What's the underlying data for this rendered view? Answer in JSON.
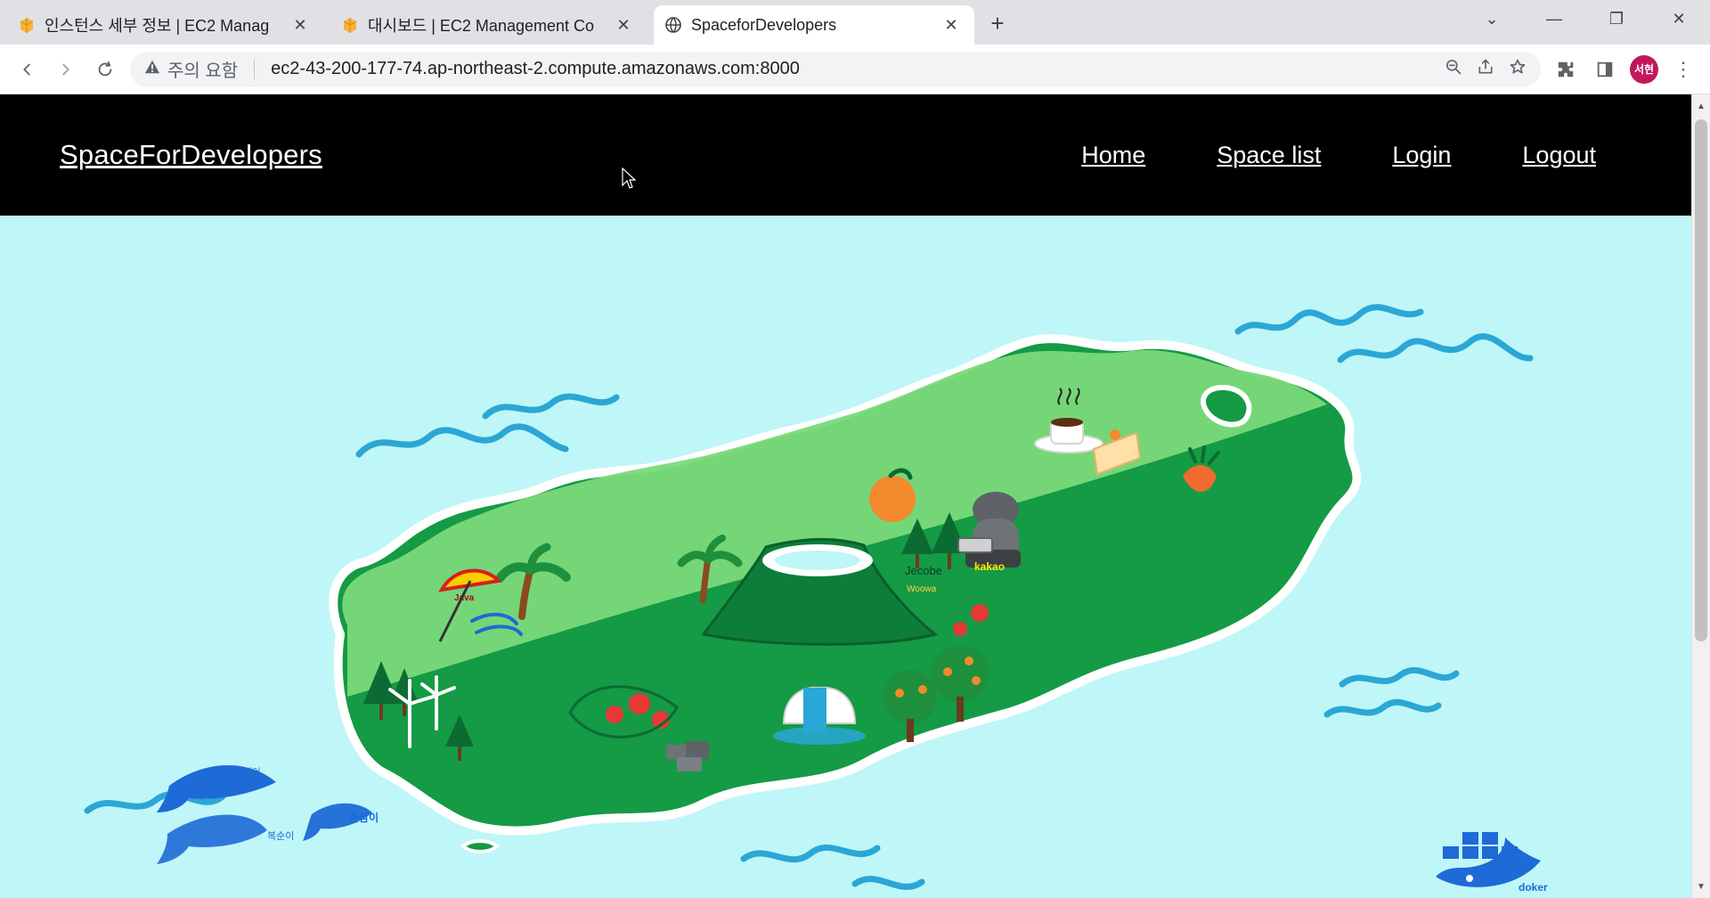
{
  "browser": {
    "tabs": [
      {
        "label": "인스턴스 세부 정보 | EC2 Manag",
        "icon": "aws-box-icon"
      },
      {
        "label": "대시보드 | EC2 Management Co",
        "icon": "aws-box-icon"
      },
      {
        "label": "SpaceforDevelopers",
        "icon": "globe-icon"
      }
    ],
    "warning_text": "주의 요함",
    "url": "ec2-43-200-177-74.ap-northeast-2.compute.amazonaws.com:8000",
    "avatar_text": "서현",
    "colors": {
      "tabbar": "#dfe1e5",
      "avatar": "#c2185b"
    }
  },
  "site": {
    "brand": "SpaceForDevelopers",
    "menu": {
      "home": "Home",
      "space_list": "Space list",
      "login": "Login",
      "logout": "Logout"
    },
    "colors": {
      "nav_bg": "#000000",
      "sea": "#bff6f7",
      "island_light": "#7ad97a",
      "island_dark": "#159a45",
      "wave": "#2aa7d6"
    },
    "map_labels": {
      "java": "Java",
      "jecobe": "Jecobe",
      "woowa": "Woowa",
      "kakao": "kakao",
      "docker": "doker",
      "dolphin_1": "상쾌어",
      "dolphin_2": "춘삼이",
      "dolphin_3": "복순이"
    }
  }
}
